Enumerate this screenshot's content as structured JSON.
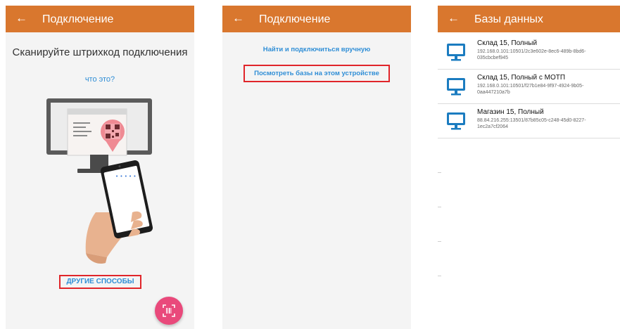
{
  "screen1": {
    "appbar": {
      "back_icon": "arrow-left-icon",
      "title": "Подключение"
    },
    "heading": "Сканируйте штрихкод подключения",
    "what_link": "что это?",
    "phone_dots": "• • • • •",
    "other_methods": "ДРУГИЕ СПОСОБЫ",
    "fab_icon": "barcode-scan-icon"
  },
  "screen2": {
    "appbar": {
      "back_icon": "arrow-left-icon",
      "title": "Подключение"
    },
    "manual_link": "Найти и подключиться вручную",
    "view_link": "Посмотреть базы на этом устройстве"
  },
  "screen3": {
    "appbar": {
      "back_icon": "arrow-left-icon",
      "title": "Базы данных"
    },
    "databases": [
      {
        "icon": "monitor-icon",
        "name": "Склад 15, Полный",
        "address": "192.168.0.101:10501/2c3e602e-8ec6-489b-8bd6-035cbcbef945"
      },
      {
        "icon": "monitor-icon",
        "name": "Склад 15, Полный с МОТП",
        "address": "192.168.0.101:10501/f27b1e84-9f97-4924-9b05-0aa447210a7b"
      },
      {
        "icon": "monitor-icon",
        "name": "Магазин 15, Полный",
        "address": "88.84.216.255:13501/87b85c05-c248-45d0-8227-1ec2a7cf2064"
      }
    ]
  },
  "colors": {
    "appbar": "#d9772e",
    "link": "#2f8ed6",
    "highlight": "#e0252a",
    "fab": "#e9497b",
    "monitor": "#1b7cc0"
  }
}
